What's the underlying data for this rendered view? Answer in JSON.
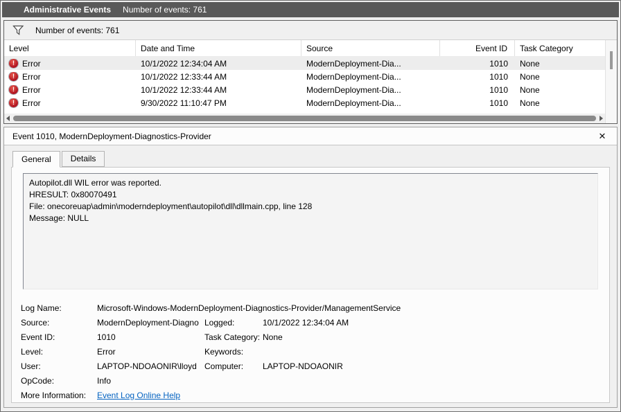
{
  "window": {
    "title": "Administrative Events",
    "events_count": "Number of events: 761"
  },
  "filter_bar": {
    "summary": "Number of events: 761"
  },
  "table": {
    "columns": [
      "Level",
      "Date and Time",
      "Source",
      "Event ID",
      "Task Category"
    ],
    "rows": [
      {
        "level": "Error",
        "datetime": "10/1/2022 12:34:04 AM",
        "source": "ModernDeployment-Dia...",
        "event_id": "1010",
        "task_category": "None",
        "selected": true
      },
      {
        "level": "Error",
        "datetime": "10/1/2022 12:33:44 AM",
        "source": "ModernDeployment-Dia...",
        "event_id": "1010",
        "task_category": "None",
        "selected": false
      },
      {
        "level": "Error",
        "datetime": "10/1/2022 12:33:44 AM",
        "source": "ModernDeployment-Dia...",
        "event_id": "1010",
        "task_category": "None",
        "selected": false
      },
      {
        "level": "Error",
        "datetime": "9/30/2022 11:10:47 PM",
        "source": "ModernDeployment-Dia...",
        "event_id": "1010",
        "task_category": "None",
        "selected": false
      }
    ]
  },
  "detail": {
    "header": "Event 1010, ModernDeployment-Diagnostics-Provider",
    "tabs": [
      {
        "label": "General",
        "active": true
      },
      {
        "label": "Details",
        "active": false
      }
    ],
    "description_lines": [
      "Autopilot.dll WIL error was reported.",
      "HRESULT: 0x80070491",
      "File: onecoreuap\\admin\\moderndeployment\\autopilot\\dll\\dllmain.cpp, line 128",
      "Message: NULL"
    ],
    "fields": [
      {
        "label": "Log Name:",
        "value": "Microsoft-Windows-ModernDeployment-Diagnostics-Provider/ManagementService",
        "label2": "",
        "value2": "",
        "wide": true
      },
      {
        "label": "Source:",
        "value": "ModernDeployment-Diagno",
        "label2": "Logged:",
        "value2": "10/1/2022 12:34:04 AM"
      },
      {
        "label": "Event ID:",
        "value": "1010",
        "label2": "Task Category:",
        "value2": "None"
      },
      {
        "label": "Level:",
        "value": "Error",
        "label2": "Keywords:",
        "value2": ""
      },
      {
        "label": "User:",
        "value": "LAPTOP-NDOAONIR\\lloyd",
        "label2": "Computer:",
        "value2": "LAPTOP-NDOAONIR"
      },
      {
        "label": "OpCode:",
        "value": "Info",
        "label2": "",
        "value2": ""
      },
      {
        "label": "More Information:",
        "value": "Event Log Online Help",
        "label2": "",
        "value2": "",
        "link": true
      }
    ]
  },
  "icons": {
    "filter": "funnel-icon",
    "error": "error-icon",
    "close": "✕"
  },
  "colors": {
    "titlebar_bg": "#595959",
    "error_red": "#aa0d1c",
    "link_blue": "#0563c1",
    "selected_row": "#ededed"
  }
}
